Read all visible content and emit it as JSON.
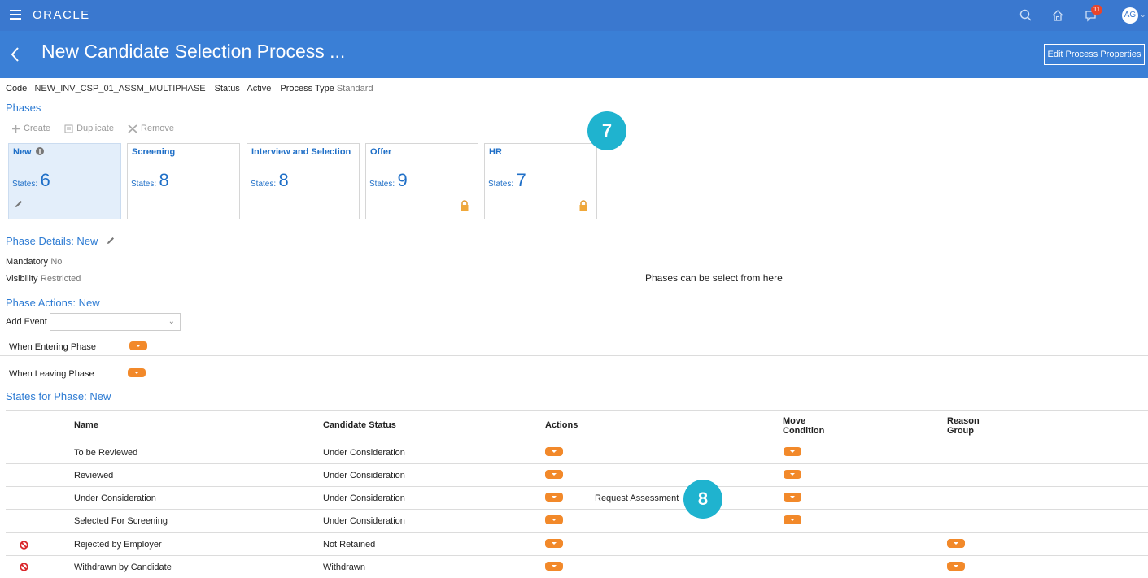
{
  "topbar": {
    "logo": "ORACLE",
    "notification_count": "11",
    "avatar_initials": "AG",
    "icons": [
      "menu-icon",
      "search-icon",
      "home-icon",
      "notifications-icon",
      "user-avatar"
    ]
  },
  "header": {
    "title": "New Candidate Selection Process ...",
    "edit_button": "Edit Process Properties"
  },
  "process_info": {
    "code_label": "Code",
    "code_value": "NEW_INV_CSP_01_ASSM_MULTIPHASE",
    "status_label": "Status",
    "status_value": "Active",
    "type_label": "Process Type",
    "type_value": "Standard"
  },
  "phases_section": {
    "title": "Phases",
    "toolbar": {
      "create": "Create",
      "duplicate": "Duplicate",
      "remove": "Remove"
    },
    "states_label": "States:",
    "cards": [
      {
        "name": "New",
        "states": "6",
        "selected": true,
        "locked": false
      },
      {
        "name": "Screening",
        "states": "8",
        "selected": false,
        "locked": false
      },
      {
        "name": "Interview and Selection",
        "states": "8",
        "selected": false,
        "locked": false
      },
      {
        "name": "Offer",
        "states": "9",
        "selected": false,
        "locked": true
      },
      {
        "name": "HR",
        "states": "7",
        "selected": false,
        "locked": true
      }
    ]
  },
  "callouts": {
    "badge_7": "7",
    "badge_8": "8",
    "phases_note": "Phases can be select from here"
  },
  "phase_details": {
    "title": "Phase Details: New",
    "mandatory_label": "Mandatory",
    "mandatory_value": "No",
    "visibility_label": "Visibility",
    "visibility_value": "Restricted"
  },
  "phase_actions": {
    "title": "Phase Actions: New",
    "add_event_label": "Add Event",
    "add_event_value": "",
    "entering_label": "When Entering Phase",
    "leaving_label": "When Leaving Phase"
  },
  "states_table": {
    "title": "States for Phase: New",
    "headers": {
      "name": "Name",
      "candidate_status": "Candidate Status",
      "actions": "Actions",
      "move_condition_1": "Move",
      "move_condition_2": "Condition",
      "reason_group_1": "Reason",
      "reason_group_2": "Group"
    },
    "rows": [
      {
        "name": "To be Reviewed",
        "status": "Under Consideration",
        "action_text": "",
        "has_move": true,
        "has_reason": false,
        "rejected": false
      },
      {
        "name": "Reviewed",
        "status": "Under Consideration",
        "action_text": "",
        "has_move": true,
        "has_reason": false,
        "rejected": false
      },
      {
        "name": "Under Consideration",
        "status": "Under Consideration",
        "action_text": "Request Assessment",
        "has_move": true,
        "has_reason": false,
        "rejected": false
      },
      {
        "name": "Selected For Screening",
        "status": "Under Consideration",
        "action_text": "",
        "has_move": true,
        "has_reason": false,
        "rejected": false
      },
      {
        "name": "Rejected by Employer",
        "status": "Not Retained",
        "action_text": "",
        "has_move": false,
        "has_reason": true,
        "rejected": true
      },
      {
        "name": "Withdrawn by Candidate",
        "status": "Withdrawn",
        "action_text": "",
        "has_move": false,
        "has_reason": true,
        "rejected": true
      }
    ]
  },
  "colors": {
    "topbar": "#3a78cf",
    "titlebar": "#3a7fd6",
    "link_blue": "#2d7bd3",
    "accent_orange": "#f2892a",
    "badge_teal": "#1fb3cf",
    "reject_red": "#d9262b"
  }
}
